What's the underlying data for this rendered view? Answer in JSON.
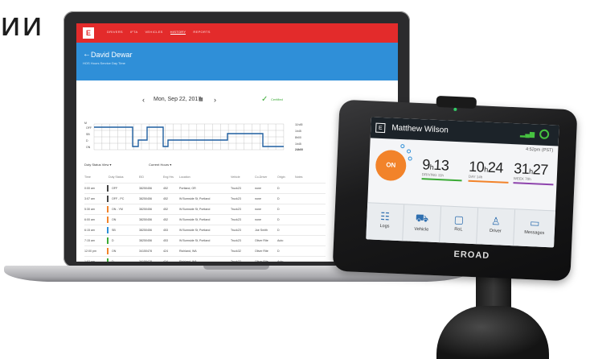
{
  "caption_fragment": "ии",
  "laptop": {
    "app_logo": "E",
    "nav": [
      "DRIVERS",
      "IFTA",
      "VEHICLES",
      "HISTORY",
      "REPORTS"
    ],
    "nav_active_index": 3,
    "driver_name": "David Dewar",
    "driver_sub": "HOS Hours Service Day Time",
    "date": "Mon, Sep 22, 2017",
    "status": "Certified",
    "graph": {
      "rows": [
        "OFF",
        "SB",
        "D",
        "ON"
      ],
      "totals": [
        "11h45",
        "1h45",
        "8h00",
        "1h45",
        "24h00"
      ]
    },
    "filters": [
      "Duty Status View",
      "Current Hours"
    ],
    "columns": [
      "Time",
      "Duty Status",
      "EID",
      "Eng Hrs",
      "Location",
      "Vehicle",
      "Co-Driver",
      "Origin",
      "Notes"
    ],
    "rows": [
      {
        "time": "0:00 am",
        "status": "OFF",
        "eid": "38250456",
        "eng": "452",
        "loc": "Portland, OR",
        "veh": "Truck23",
        "co": "none",
        "origin": "D",
        "color": "#444444"
      },
      {
        "time": "3:07 am",
        "status": "OFF - PC",
        "eid": "38250456",
        "eng": "452",
        "loc": "W Burnside St, Portland",
        "veh": "Truck23",
        "co": "none",
        "origin": "D",
        "color": "#444444"
      },
      {
        "time": "5:30 am",
        "status": "ON - YM",
        "eid": "38250456",
        "eng": "452",
        "loc": "W Burnside St, Portland",
        "veh": "Truck23",
        "co": "none",
        "origin": "D",
        "color": "#f2832a"
      },
      {
        "time": "6:00 am",
        "status": "ON",
        "eid": "38250456",
        "eng": "452",
        "loc": "W Burnside St, Portland",
        "veh": "Truck23",
        "co": "none",
        "origin": "D",
        "color": "#f2832a"
      },
      {
        "time": "6:15 am",
        "status": "SB",
        "eid": "38250456",
        "eng": "453",
        "loc": "W Burnside St, Portland",
        "veh": "Truck23",
        "co": "Joe Smith",
        "origin": "D",
        "color": "#2f8fd8"
      },
      {
        "time": "7:15 am",
        "status": "D",
        "eid": "38250456",
        "eng": "453",
        "loc": "W Burnside St, Portland",
        "veh": "Truck23",
        "co": "Oliver Rite",
        "origin": "Auto",
        "color": "#3aaa35"
      },
      {
        "time": "12:00 pm",
        "status": "ON",
        "eid": "34150478",
        "eng": "424",
        "loc": "Richland, WA",
        "veh": "Truck32",
        "co": "Oliver Rite",
        "origin": "D",
        "color": "#f2832a"
      },
      {
        "time": "1:02 pm",
        "status": "D",
        "eid": "34150478",
        "eng": "424",
        "loc": "Richland, WA",
        "veh": "Truck32",
        "co": "Oliver Rite",
        "origin": "Auto",
        "color": "#3aaa35"
      }
    ]
  },
  "device": {
    "logo": "E",
    "driver": "Matthew Wilson",
    "time": "4:52pm (PST)",
    "status": "ON",
    "counters": [
      {
        "hours": "9",
        "mins": "13",
        "label": "DRIVING 11h",
        "color": "#3aaa35"
      },
      {
        "hours": "10",
        "mins": "24",
        "label": "DAY 14h",
        "color": "#f2832a"
      },
      {
        "hours": "31",
        "mins": "27",
        "label": "WEEK 70h",
        "color": "#8e44ad"
      }
    ],
    "tabs": [
      {
        "label": "Logs",
        "icon": "logs-icon"
      },
      {
        "label": "Vehicle",
        "icon": "truck-icon"
      },
      {
        "label": "RoL",
        "icon": "document-icon"
      },
      {
        "label": "Driver",
        "icon": "person-icon"
      },
      {
        "label": "Messages",
        "icon": "chat-icon"
      }
    ],
    "brand": "EROAD"
  },
  "colors": {
    "red": "#e32b2b",
    "blue": "#2f8fd8",
    "green": "#3aaa35",
    "orange": "#f2832a"
  }
}
